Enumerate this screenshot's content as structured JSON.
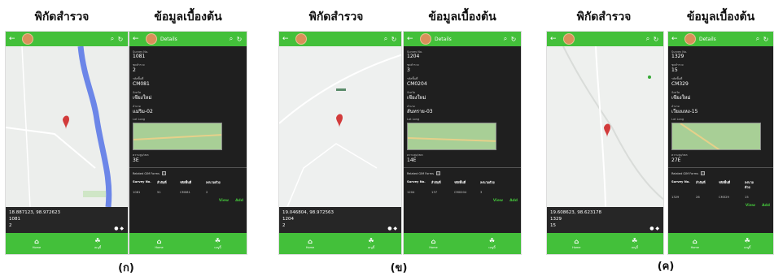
{
  "caption_map": "พิกัดสำรวจ",
  "caption_detail": "ข้อมูลเบื้องต้น",
  "app": {
    "details_title": "Details"
  },
  "labels": {
    "survey_no": "Survey No.",
    "house_no": "ชุดสำรวจ",
    "id": "รหัสพื้นที่",
    "province": "จังหวัด",
    "district": "อำเภอ",
    "latlng": "Lat Long",
    "area": "ความสูง/เขต",
    "related": "Related GIM Forms",
    "col1": "Survey No.",
    "col2": "ลำดับที่",
    "col3": "รหัสพื้นที่",
    "col4": "ลงนามด้วย",
    "view": "View",
    "add": "Add",
    "home": "Home",
    "menu": "เมนูนี้"
  },
  "panels": [
    {
      "sub": "(ก)",
      "coord": "18.887123, 98.972623",
      "survey": "1081",
      "count": "2",
      "survey_no": "1081",
      "house_no": "2",
      "id": "CM081",
      "province": "เชียงใหม่",
      "district": "แม่ริม-02",
      "area": "3E",
      "row": [
        "1081",
        "51",
        "CM081",
        "2"
      ]
    },
    {
      "sub": "(ข)",
      "coord": "19.046804, 98.972563",
      "survey": "1204",
      "count": "2",
      "survey_no": "1204",
      "house_no": "3",
      "id": "CM0204",
      "province": "เชียงใหม่",
      "district": "สันทราย-03",
      "area": "14E",
      "row": [
        "1204",
        "137",
        "CM0204",
        "3"
      ]
    },
    {
      "sub": "(ค)",
      "coord": "19.608623, 98.623178",
      "survey": "1329",
      "count": "15",
      "survey_no": "1329",
      "house_no": "15",
      "id": "CM329",
      "province": "เชียงใหม่",
      "district": "เวียงแหง-15",
      "area": "27E",
      "row": [
        "1329",
        "26",
        "CM329",
        "15"
      ]
    }
  ]
}
